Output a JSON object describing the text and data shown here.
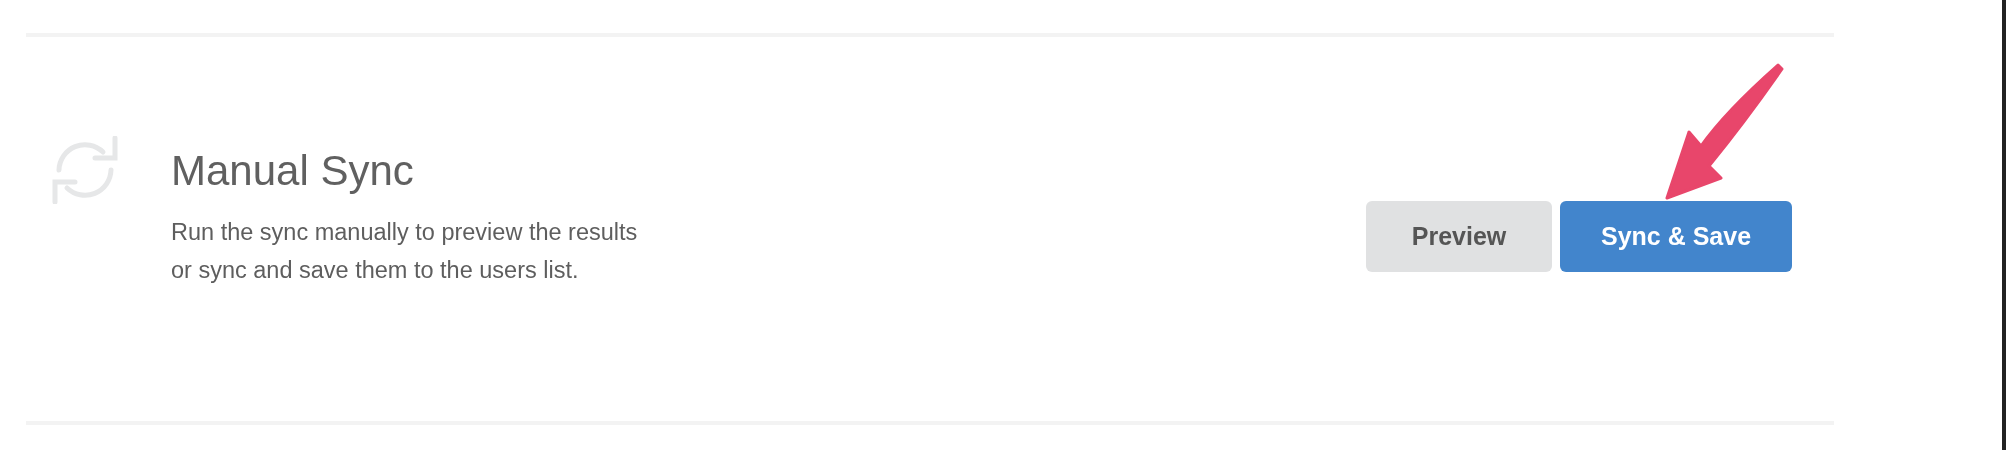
{
  "section": {
    "title": "Manual Sync",
    "description": "Run the sync manually to preview the results or sync and save them to the users list."
  },
  "buttons": [
    {
      "label": "Preview",
      "kind": "secondary"
    },
    {
      "label": "Sync & Save",
      "kind": "primary"
    }
  ]
}
